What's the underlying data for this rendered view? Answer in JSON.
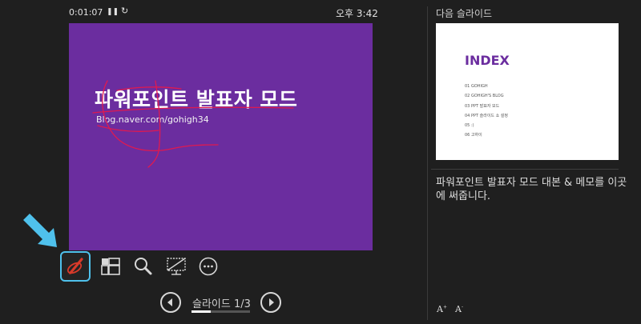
{
  "top_bar": {
    "elapsed_time": "0:01:07",
    "pause_glyph": "❚❚",
    "restart_glyph": "↻",
    "clock": "오후 3:42"
  },
  "current_slide": {
    "title": "파워포인트 발표자 모드",
    "subtitle": "Blog.naver.com/gohigh34",
    "background": "#6b2d9f",
    "ink_color": "#e0194f"
  },
  "toolbar": {
    "pen_tool": "pen-icon",
    "see_all_slides": "grid-icon",
    "zoom": "magnifier-icon",
    "black_screen": "screen-icon",
    "more_options": "more-icon",
    "highlight": "#4fc1ec"
  },
  "navigation": {
    "counter": "슬라이드 1/3",
    "current": 1,
    "total": 3
  },
  "next_slide": {
    "label": "다음 슬라이드",
    "title": "INDEX",
    "items": [
      "01  GOHIGH",
      "02  GOHIGH'S BLOG",
      "03  PPT 발표자 모드",
      "04  PPT 슬라이드 쇼 설정",
      "05  :)",
      "06  고하이"
    ]
  },
  "notes": {
    "text": "파워포인트 발표자 모드 대본 & 메모를 이곳에 써줍니다."
  },
  "font_controls": {
    "increase": "A",
    "decrease": "A",
    "increase_mark": "+",
    "decrease_mark": "-"
  }
}
